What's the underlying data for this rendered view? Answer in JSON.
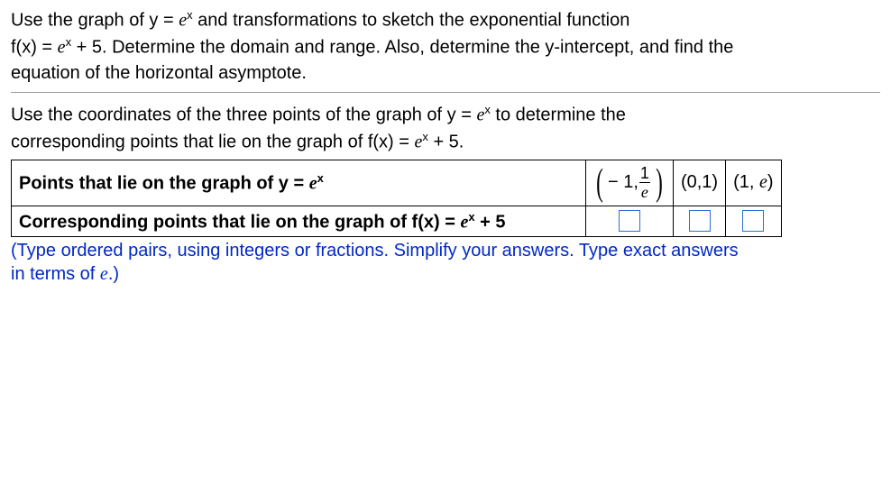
{
  "intro": {
    "l1a": "Use the graph of y = ",
    "l1b": " and transformations to sketch the exponential function",
    "l2a": "f(x) = ",
    "l2b": " + 5. Determine the domain and range. Also, determine the y-intercept, and find the",
    "l3": "equation of the horizontal asymptote."
  },
  "mid": {
    "l1a": "Use the coordinates of the three points of the graph of y = ",
    "l1b": " to determine the",
    "l2a": "corresponding points that lie on the graph of f(x) = ",
    "l2b": " + 5."
  },
  "table": {
    "row1_label_a": "Points that lie on the graph of y = ",
    "row2_label_a": "Corresponding points that lie on the graph of f(x) = ",
    "row2_label_b": " + 5",
    "p1_pre": "− 1,",
    "p1_num": "1",
    "p1_den": "e",
    "p2": "(0,1)",
    "p3a": "(1, ",
    "p3b": ")"
  },
  "e_glyph": "e",
  "x_glyph": "x",
  "instruction": "(Type ordered pairs, using integers or fractions. Simplify your answers. Type exact answers in terms of e.)"
}
